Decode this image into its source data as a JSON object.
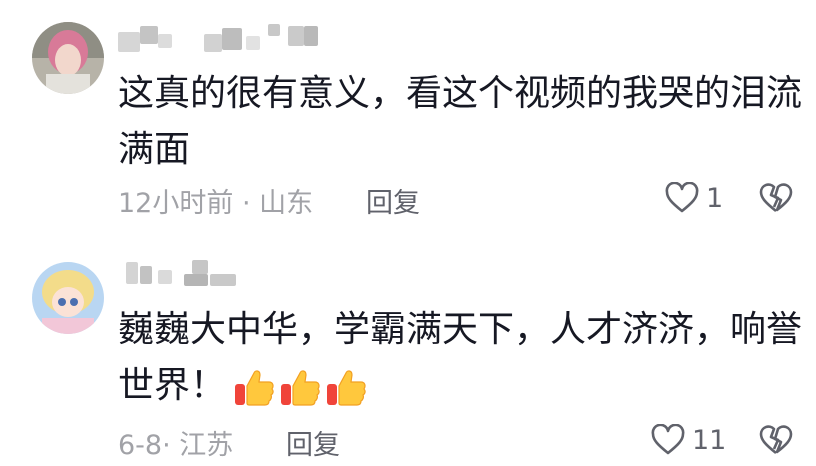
{
  "comments": [
    {
      "username": "",
      "text_lines": [
        "这真的很有意义，看这个视频的我哭的泪流",
        "满面"
      ],
      "time": "12小时前",
      "location": "山东",
      "reply_label": "回复",
      "like_count": "1",
      "emojis": []
    },
    {
      "username": "",
      "text_lines": [
        "巍巍大中华，学霸满天下，人才济济，响誉",
        "世界！"
      ],
      "time": "6-8",
      "location": "江苏",
      "reply_label": "回复",
      "like_count": "11",
      "emojis": [
        "thumbs-up-icon",
        "thumbs-up-icon",
        "thumbs-up-icon"
      ]
    }
  ],
  "colors": {
    "text": "#161823",
    "meta": "#a1a2a7",
    "action": "#60626b"
  }
}
